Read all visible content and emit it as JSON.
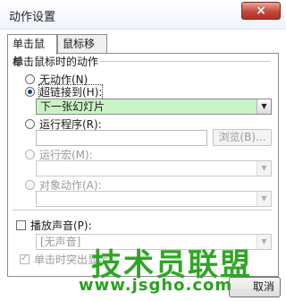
{
  "window": {
    "title": "动作设置",
    "close_label": "×"
  },
  "tabs": [
    {
      "label": "单击鼠标"
    },
    {
      "label": "鼠标移过"
    }
  ],
  "group": {
    "title": "单击鼠标时的动作"
  },
  "options": {
    "none": {
      "label": "无动作(N)"
    },
    "hyperlink": {
      "label": "超链接到(H):",
      "value": "下一张幻灯片"
    },
    "program": {
      "label": "运行程序(R):",
      "browse_label": "浏览(B)..."
    },
    "macro": {
      "label": "运行宏(M):"
    },
    "object": {
      "label": "对象动作(A):"
    }
  },
  "sound": {
    "label": "播放声音(P):",
    "value": "[无声音]"
  },
  "highlight": {
    "label": "单击时突出显示"
  },
  "footer": {
    "cancel_label": "取消"
  },
  "watermark": {
    "line1": "技术员联盟",
    "line2": "www.jsgho.com"
  }
}
